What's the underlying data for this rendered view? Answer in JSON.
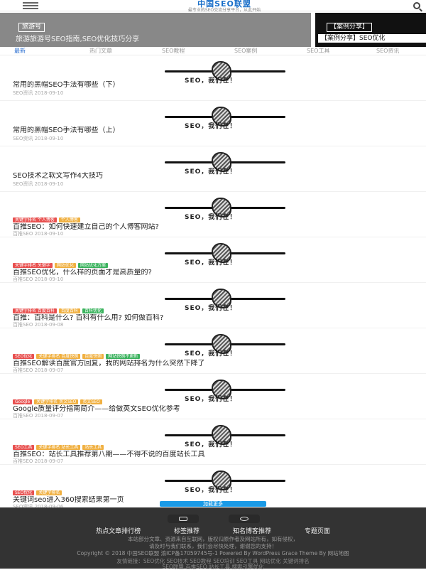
{
  "header": {
    "site_name": "中国SEO联盟",
    "slogan": "最专业的SEO交流分享平台，从此开始"
  },
  "slider": {
    "main_tag": "旅游号",
    "main_caption": "旅游旅游号SEO指南,SEO优化技巧分享",
    "side_tag": "【案例分享】",
    "side_caption": "【案例分享】SEO优化"
  },
  "tabs": [
    "最新",
    "热门文章",
    "SEO教程",
    "SEO案例",
    "SEO工具",
    "SEO资讯"
  ],
  "thumb_brand": "SEO，我们在！",
  "articles": [
    {
      "badges": [],
      "title": "常用的黑帽SEO手法有哪些（下）",
      "meta": "SEO资讯  2018-09-10"
    },
    {
      "badges": [],
      "title": "常用的黑帽SEO手法有哪些（上）",
      "meta": "SEO资讯  2018-09-10"
    },
    {
      "badges": [],
      "title": "SEO技术之软文写作4大技巧",
      "meta": "SEO资讯  2018-09-10"
    },
    {
      "badges": [
        {
          "text": "关键字排名 个人博客",
          "color": "#e8504f"
        },
        {
          "text": "个人博客",
          "color": "#f0b041"
        }
      ],
      "title": "百推SEO：如何快速建立自己的个人博客网站?",
      "meta": "百推SEO  2018-09-10"
    },
    {
      "badges": [
        {
          "text": "关键字排名 关键字",
          "color": "#e8504f"
        },
        {
          "text": "网站优化",
          "color": "#f0b041"
        },
        {
          "text": "网站优化方案",
          "color": "#3bb35e"
        }
      ],
      "title": "百推SEO优化，什么样的页面才是高质量的?",
      "meta": "百推SEO  2018-09-10"
    },
    {
      "badges": [
        {
          "text": "关键字排名 百度百科",
          "color": "#e8504f"
        },
        {
          "text": "百度百科",
          "color": "#f0b041"
        },
        {
          "text": "百科优化",
          "color": "#3bb35e"
        }
      ],
      "title": "百推：百科是什么? 百科有什么用? 如何做百科?",
      "meta": "百推SEO  2018-09-08"
    },
    {
      "badges": [
        {
          "text": "SEO优化",
          "color": "#e8504f"
        },
        {
          "text": "关键字排名 百度快照",
          "color": "#f0b041"
        },
        {
          "text": "百度快照",
          "color": "#f0b041"
        },
        {
          "text": "网站快照不更新",
          "color": "#3bb35e"
        }
      ],
      "title": "百推SEO解读百度官方回复，我的网站排名为什么突然下降了",
      "meta": "百推SEO  2018-09-07"
    },
    {
      "badges": [
        {
          "text": "Google",
          "color": "#e8504f"
        },
        {
          "text": "关键字排名 英文SEO",
          "color": "#f0b041"
        },
        {
          "text": "英文SEO",
          "color": "#f0b041"
        }
      ],
      "title": "Google质量评分指南简介——给做英文SEO优化参考",
      "meta": "百推SEO  2018-09-07"
    },
    {
      "badges": [
        {
          "text": "SEO工具",
          "color": "#e8504f"
        },
        {
          "text": "关键字排名 站长工具",
          "color": "#f0b041"
        },
        {
          "text": "站长工具",
          "color": "#f0b041"
        }
      ],
      "title": "百推SEO：站长工具推荐第八期——不得不说的百度站长工具",
      "meta": "百推SEO  2018-09-07"
    },
    {
      "badges": [
        {
          "text": "SEO优化",
          "color": "#e8504f"
        },
        {
          "text": "关键字排名",
          "color": "#f0b041"
        }
      ],
      "title": "关键词seo进入360搜索结果第一页",
      "meta": "SEO资讯  2018-09-06"
    }
  ],
  "load_more": "加载更多",
  "footer": {
    "links": [
      "热点文章排行榜",
      "标签推荐",
      "知名博客推荐",
      "专题页面"
    ],
    "line1": "本站部分文章、资源来自互联网，版权归原作者及网站所有，如有侵权，",
    "line2": "请及时与我们联系，我们会尽快处理，谢谢您的支持！",
    "line3": "Copyright © 2018 中国SEO联盟 渝ICP备17059745号-1 Powered By WordPress Grace Theme By 网站地图",
    "line4": "友情链接：SEO优化 SEO技术 SEO教程 SEO培训 SEO工具 网站优化 关键词排名",
    "line5": "SEO联盟 百推SEO 站长工具 搜索引擎优化"
  }
}
